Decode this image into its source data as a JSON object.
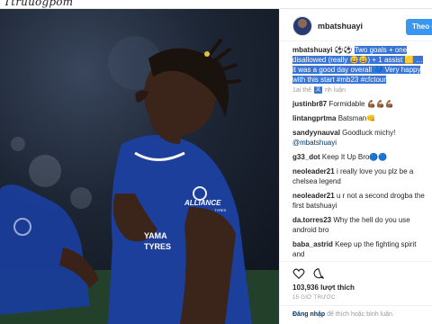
{
  "site": {
    "logo_text": "Ttruuogpom"
  },
  "post": {
    "author": "mbatshuayi",
    "follow_label": "Theo dõi",
    "caption_user": "mbatshuayi",
    "caption_plain": "⚽⚽",
    "caption_selected_1": "Two goals + one disallowed (really 😄😄) + 1 assist 🟨 … it was a good day overall 💙 Very happy with this start ",
    "caption_selected_2": "#mb23 #cfctour",
    "timeline_label": "1ai thế",
    "timeline_tail": "nh luận"
  },
  "comments": [
    {
      "user": "justinbr87",
      "text": "Formidable 💪🏾💪🏾💪🏾"
    },
    {
      "user": "lintangprtma",
      "text": "Batsman👊"
    },
    {
      "user": "sandyynauval",
      "text": "Goodluck michy!",
      "mention": "@mbatshuayi"
    },
    {
      "user": "g33_dot",
      "text": "Keep It Up Bro🔵🔵"
    },
    {
      "user": "neoleader21",
      "text": "i really love you plz be a chelsea legend"
    },
    {
      "user": "neoleader21",
      "text": "u r not a second drogba the first batshuayi"
    },
    {
      "user": "da.torres23",
      "text": "Why the hell do you use android bro"
    },
    {
      "user": "baba_astrid",
      "text": "Keep up the fighting spirit and"
    }
  ],
  "actions": {
    "likes": "103,936 lượt thích",
    "time": "15 GIỜ TRƯỚC",
    "login_link": "Đăng nhập",
    "login_text": " để thích hoặc bình luận."
  },
  "jersey": {
    "sponsor": "ALLIANCE",
    "sponsor_sub": "TYRES",
    "chest": "YAMA TYRES"
  },
  "colors": {
    "accent": "#3897f0",
    "selection": "#3875d7",
    "jersey": "#1c3f9c"
  }
}
